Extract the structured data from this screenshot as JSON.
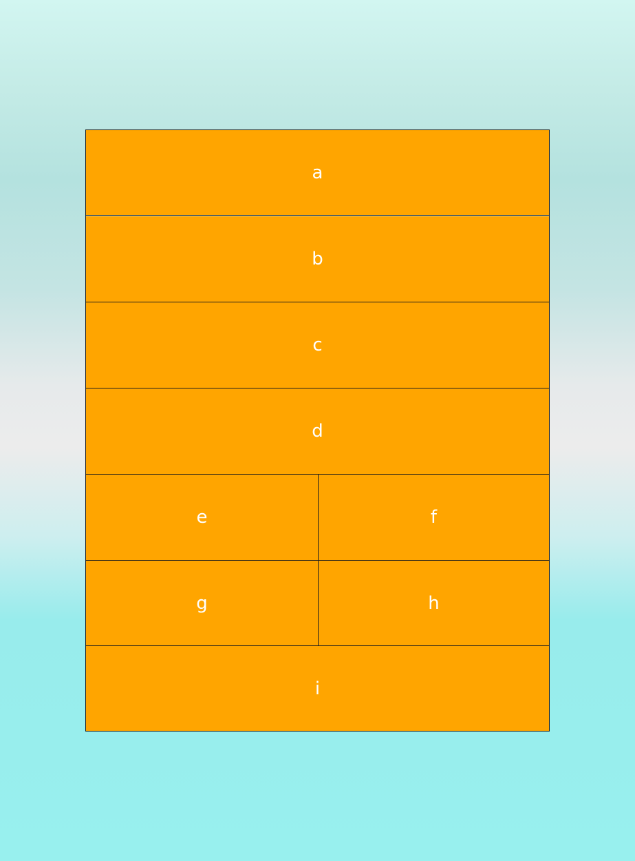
{
  "cells": {
    "a": "a",
    "b": "b",
    "c": "c",
    "d": "d",
    "e": "e",
    "f": "f",
    "g": "g",
    "h": "h",
    "i": "i"
  },
  "colors": {
    "cell_background": "#ffa500",
    "cell_text": "#ffffff",
    "border": "#1c1c1c"
  }
}
